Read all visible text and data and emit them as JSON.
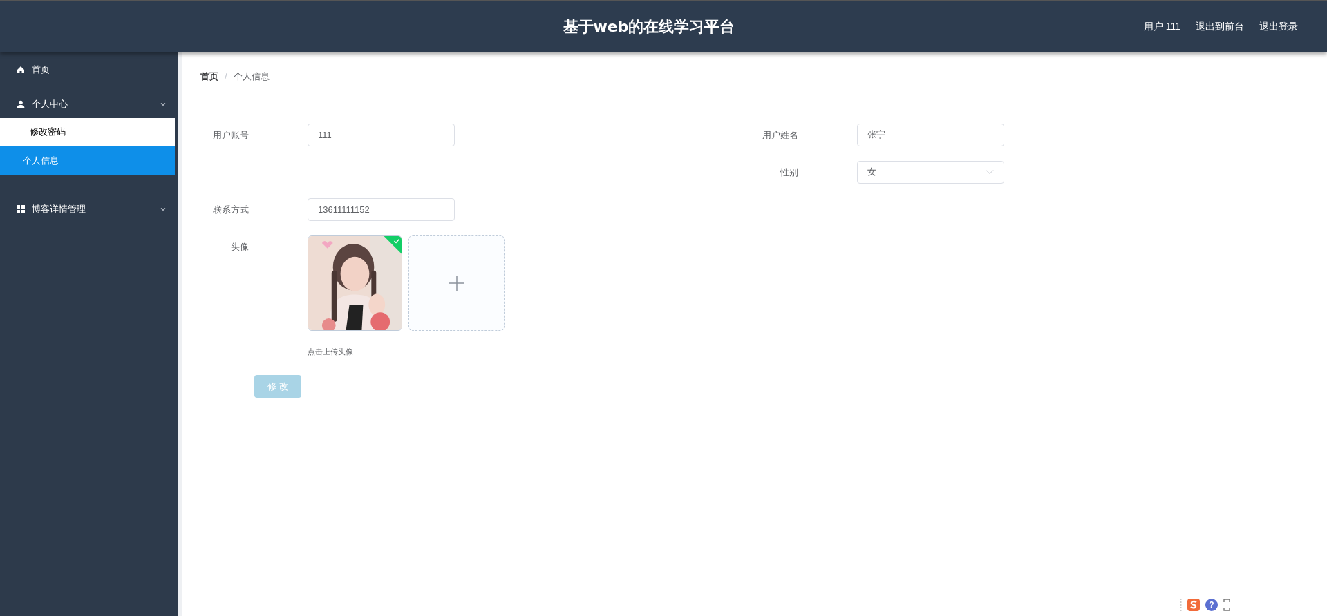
{
  "header": {
    "title": "基于web的在线学习平台",
    "user": "用户 111",
    "links": [
      "退出到前台",
      "退出登录"
    ]
  },
  "sidebar": {
    "items": [
      {
        "label": "首页",
        "kind": "home",
        "has_submenu": false
      },
      {
        "label": "个人中心",
        "kind": "user",
        "has_submenu": true,
        "children": [
          {
            "label": "修改密码",
            "selected": false
          },
          {
            "label": "个人信息",
            "selected": true
          }
        ]
      },
      {
        "label": "博客详情管理",
        "kind": "grid",
        "has_submenu": true
      }
    ]
  },
  "breadcrumb": {
    "items": [
      "首页",
      "个人信息"
    ],
    "separator": "/"
  },
  "form": {
    "rows": [
      {
        "left": {
          "label": "用户账号",
          "kind": "text",
          "value": "111"
        },
        "right": {
          "label": "用户姓名",
          "kind": "text",
          "value": "张宇"
        }
      },
      {
        "right": {
          "label": "性别",
          "kind": "select",
          "value": "女"
        }
      },
      {
        "left": {
          "label": "联系方式",
          "kind": "text",
          "value": "13611111152"
        }
      },
      {
        "left": {
          "label": "头像",
          "kind": "upload",
          "uploaded": true,
          "hint": "点击上传头像"
        }
      }
    ],
    "submit": "修 改"
  },
  "tray": {
    "help": "?"
  }
}
